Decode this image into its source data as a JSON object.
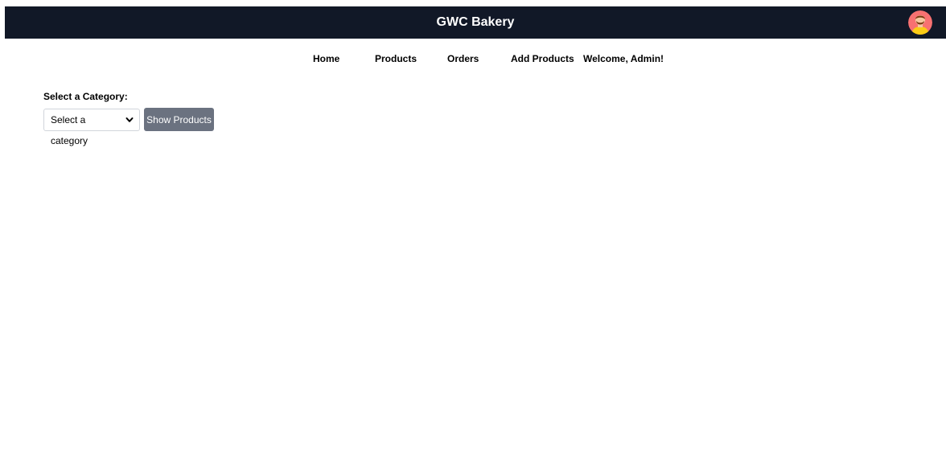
{
  "header": {
    "title": "GWC Bakery",
    "avatar_icon": "user-avatar-icon",
    "background_color": "#111827"
  },
  "nav": {
    "items": [
      {
        "label": "Home"
      },
      {
        "label": "Products"
      },
      {
        "label": "Orders"
      },
      {
        "label": "Add Products"
      }
    ],
    "welcome": "Welcome, Admin!"
  },
  "filter": {
    "label": "Select a Category:",
    "select_value": "Select a category",
    "button_label": "Show Products",
    "button_color": "#6b7280"
  }
}
